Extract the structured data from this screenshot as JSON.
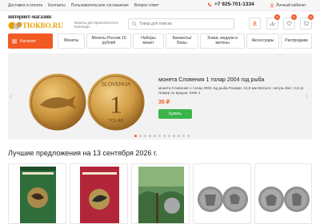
{
  "topbar": {
    "links": [
      "Доставка и оплата",
      "Контакты",
      "Пользовательское соглашение",
      "Вопрос-ответ"
    ],
    "phone": "+7 925-701-1334",
    "cabinet": "Личный кабинет"
  },
  "header": {
    "logo_line1": "интернет-магазин",
    "logo_line2": "ТЮКВО.RU",
    "tagline": "Монеты для практичности и Коллекци...",
    "search_placeholder": "Товар для поиска",
    "badges": {
      "compare": "0",
      "favorites": "0",
      "cart": "0"
    }
  },
  "nav": {
    "catalog": "Каталог",
    "items": [
      "Монеты",
      "Монеты России 10 рублей",
      "Наборы монет",
      "Банкноты/ Боны",
      "Знаки, медали и жетоны",
      "Аксессуары",
      "Распродажа"
    ]
  },
  "banner": {
    "title": "монета Словения 1 толар 2004 год рыба",
    "description": "монета Словения 1 толар 2004 год рыба Размер: 21,9 мм Металл: латунь Вес: 4,5 гр Номер по Краузе: KM# 4",
    "price": "30 ₽",
    "buy": "Купить",
    "coin_text": "SLOVENIJA",
    "coin_value": "1",
    "coin_unit": "TOLAR",
    "slides_total": 12,
    "active_slide": 1
  },
  "offers": {
    "title": "Лучшие предложения на 13 сентября 2026 г."
  },
  "colors": {
    "accent": "#f25a24",
    "buy": "#3cb44b"
  }
}
